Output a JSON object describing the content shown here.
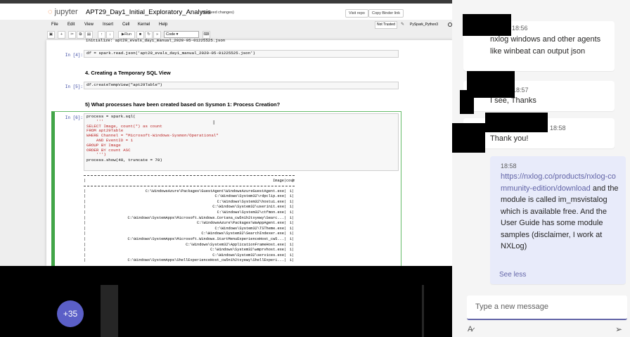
{
  "notebook": {
    "title": "APT29_Day1_Initial_Exploratory_Analysis",
    "unsaved": "(unsaved changes)",
    "header_buttons": [
      "Visit repo",
      "Copy Binder link"
    ],
    "menu": [
      "File",
      "Edit",
      "View",
      "Insert",
      "Cell",
      "Kernel",
      "Help"
    ],
    "trust_status": "Not Trusted",
    "kernel": "PySpark_Python3",
    "toolbar": {
      "run": "Run",
      "cell_type": "Code"
    },
    "cells": {
      "c0_partial": "initialize: apt29_evals_day1_manual_2020-05-01225525.json",
      "c4_prompt": "In [4]:",
      "c4_code": "df = spark.read.json('apt29_evals_day1_manual_2020-05-01225525.json')",
      "h4": "4. Creating a Temporary SQL View",
      "c5_prompt": "In [5]:",
      "c5_code": "df.createTempView(\"apt29Table\")",
      "h5": "5) What processes have been created based on Sysmon 1: Process Creation?",
      "c6_prompt": "In [6]:",
      "c6_line1": "process = spark.sql(",
      "c6_line2": "    '''",
      "c6_line3": "SELECT Image, count(*) as count",
      "c6_line4": "FROM apt29Table",
      "c6_line5": "WHERE Channel = \"Microsoft-Windows-Sysmon/Operational\"",
      "c6_line6": "    AND EventID = 1",
      "c6_line7": "GROUP BY Image",
      "c6_line8": "ORDER BY count ASC",
      "c6_line9": "    ''')",
      "c6_line10": "process.show(40, truncate = 70)"
    },
    "output": {
      "header_image": "Image",
      "header_count": "count",
      "rows": [
        {
          "image": "C:\\WindowsAzure\\Packages\\GuestAgent\\WindowsAzureGuestAgent.exe",
          "count": "1"
        },
        {
          "image": "C:\\Windows\\System32\\rdpclip.exe",
          "count": "1"
        },
        {
          "image": "C:\\Windows\\System32\\hostui.exe",
          "count": "1"
        },
        {
          "image": "C:\\Windows\\System32\\userinit.exe",
          "count": "1"
        },
        {
          "image": "C:\\Windows\\System32\\ctfmon.exe",
          "count": "1"
        },
        {
          "image": "C:\\Windows\\SystemApps\\Microsoft.Windows.Cortana_cw5n1h2txyewy\\Searc...",
          "count": "1"
        },
        {
          "image": "C:\\WindowsAzure\\Packages\\WaAppAgent.exe",
          "count": "1"
        },
        {
          "image": "C:\\Windows\\System32\\TSTheme.exe",
          "count": "1"
        },
        {
          "image": "C:\\Windows\\System32\\SearchIndexer.exe",
          "count": "1"
        },
        {
          "image": "C:\\Windows\\SystemApps\\Microsoft.Windows.StartMenuExperienceHost_cw5...",
          "count": "1"
        },
        {
          "image": "C:\\Windows\\System32\\ApplicationFrameHost.exe",
          "count": "1"
        },
        {
          "image": "C:\\Windows\\System32\\wmprvhost.exe",
          "count": "1"
        },
        {
          "image": "C:\\Windows\\System32\\services.exe",
          "count": "1"
        },
        {
          "image": "C:\\Windows\\SystemApps\\ShellExperienceHost_cw5n1h2txyewy\\ShellExperi...",
          "count": "1"
        }
      ]
    }
  },
  "meeting": {
    "overflow_count": "+35"
  },
  "chat": {
    "messages": [
      {
        "time": "18:56",
        "text": "nxlog windows and other agents like winbeat can output json"
      },
      {
        "time": "18:57",
        "text": "I see, Thanks"
      },
      {
        "time": "18:58",
        "text": "Thank you!"
      }
    ],
    "my_message": {
      "time": "18:58",
      "link": "https://nxlog.co/products/nxlog-community-edition/download",
      "text": " and the module is called im_msvistalog which is available free. And the User Guide has some module samples (disclaimer, I work at NXLog)"
    },
    "see_less": "See less",
    "compose_placeholder": "Type a new message"
  },
  "colors": {
    "teams_accent": "#6264a7",
    "jupyter_orange": "#f37726",
    "selected_cell": "#42a548"
  }
}
